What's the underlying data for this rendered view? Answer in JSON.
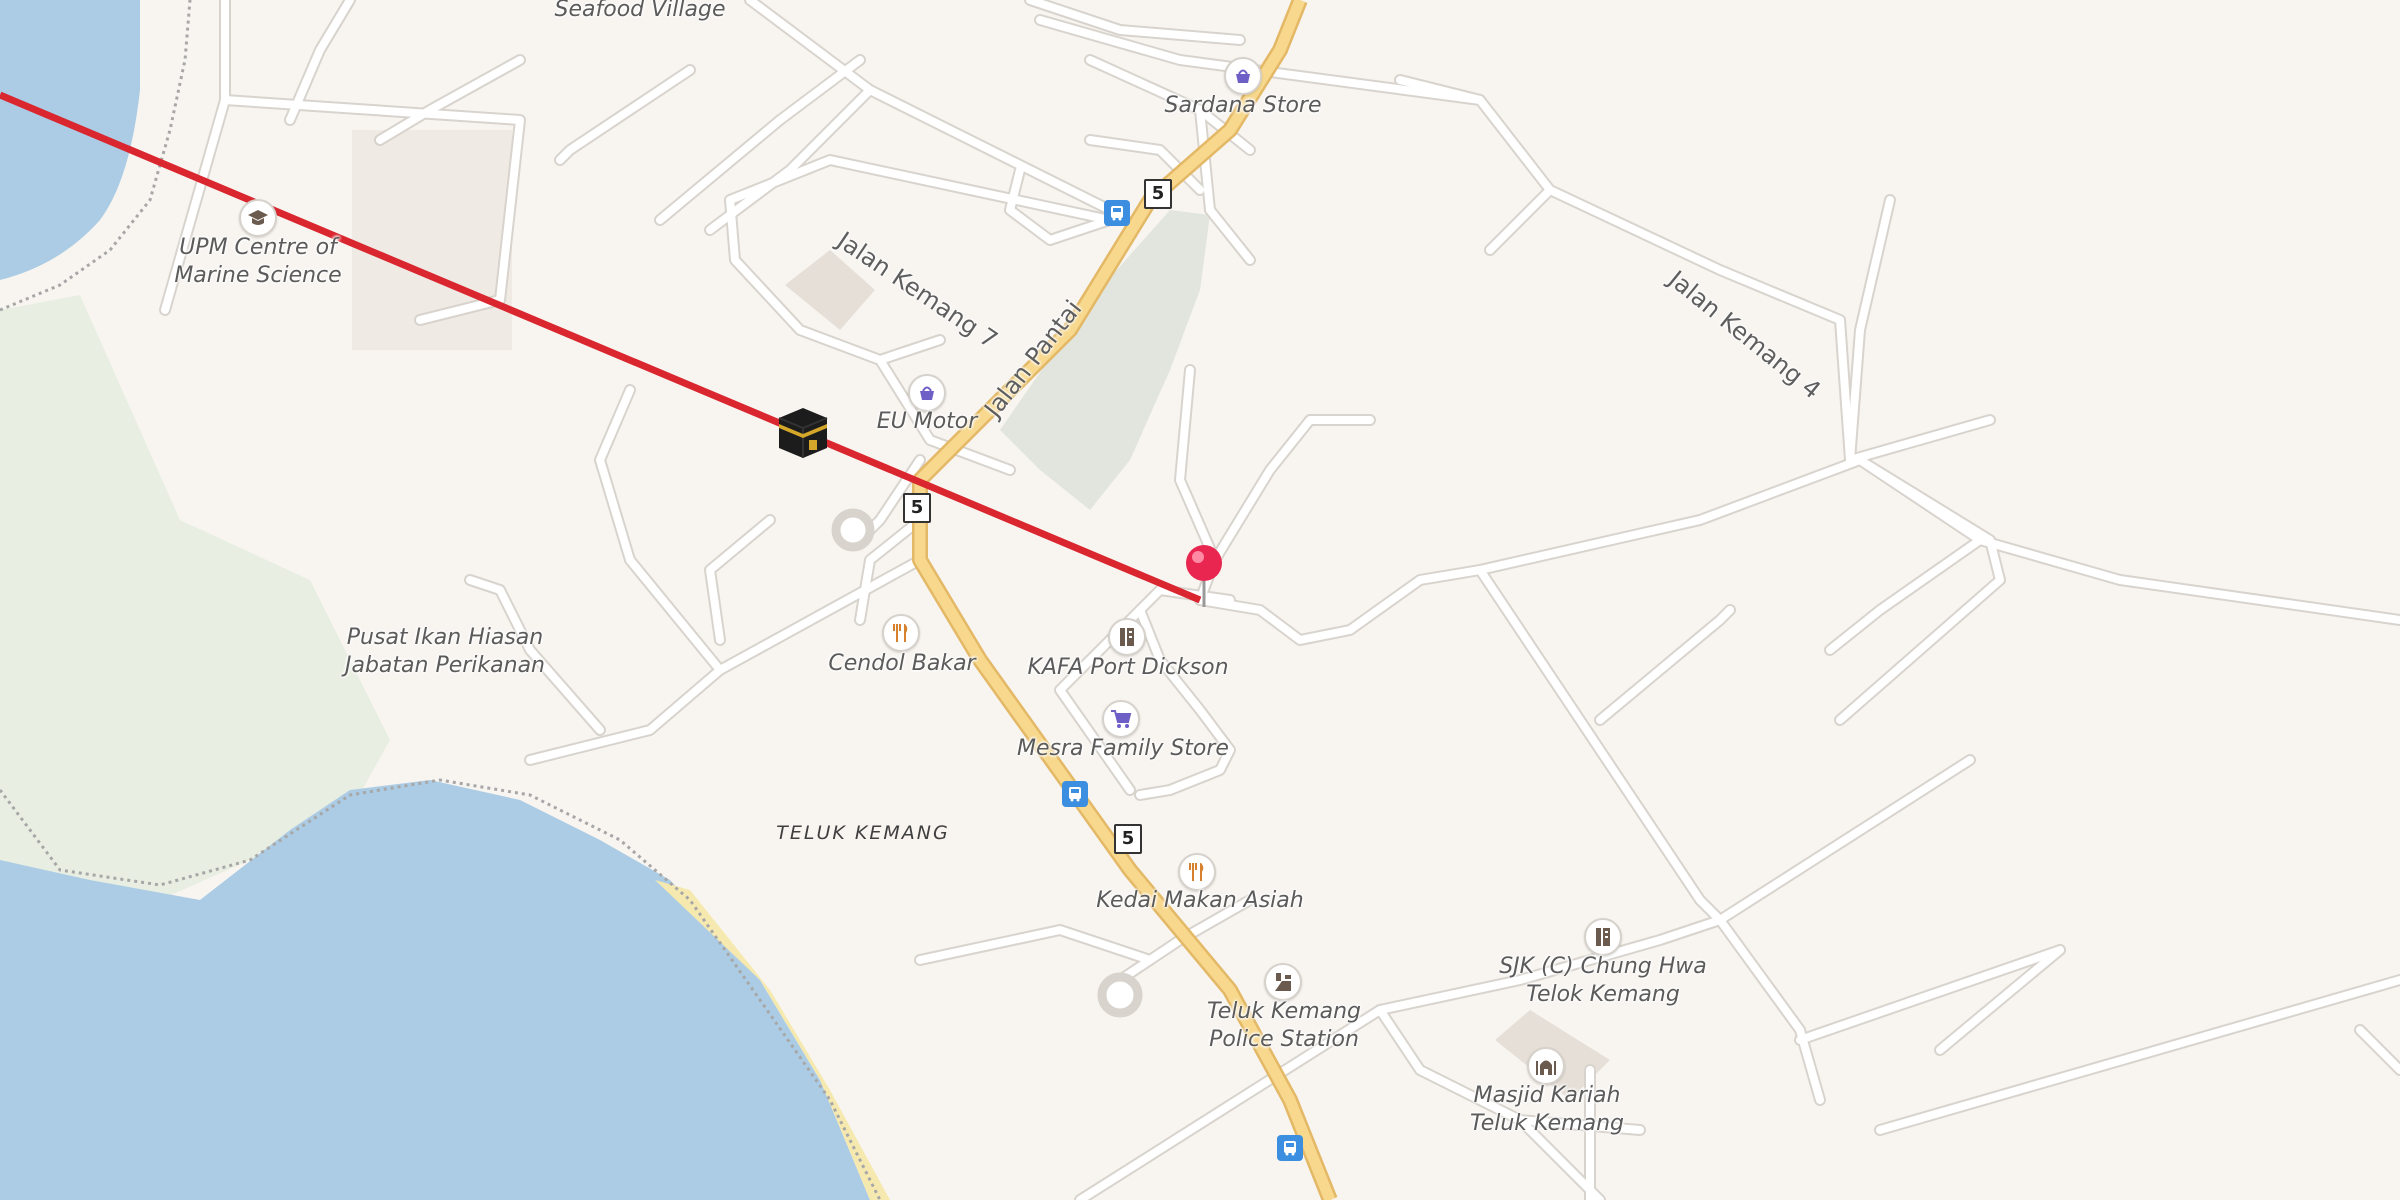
{
  "colors": {
    "water": "#abcce4",
    "land": "#f8f5f1",
    "park": "#e8efe2",
    "road_minor": "#ffffff",
    "road_casing": "#d8d3cd",
    "main_road": "#f7d88d",
    "main_road_casing": "#e3b866",
    "beach": "#f6e9b0",
    "qibla_line": "#d9262f",
    "pin": "#e8264f",
    "poi_purple": "#6e5fc7",
    "poi_orange": "#d7812e",
    "poi_brown": "#6b5a4e",
    "bus_blue": "#3b8ee0"
  },
  "places": {
    "seafood": "Seafood Village",
    "sardana": "Sardana Store",
    "upm": [
      "UPM Centre of",
      "Marine Science"
    ],
    "eu_motor": "EU Motor",
    "pusat": [
      "Pusat Ikan Hiasan",
      "Jabatan Perikanan"
    ],
    "cendol": "Cendol Bakar",
    "kafa": "KAFA Port Dickson",
    "mesra": "Mesra Family Store",
    "kedai": "Kedai Makan Asiah",
    "police": [
      "Teluk Kemang",
      "Police Station"
    ],
    "sjk": [
      "SJK (C) Chung Hwa",
      "Telok Kemang"
    ],
    "masjid": [
      "Masjid Kariah",
      "Teluk Kemang"
    ]
  },
  "area_label": "TELUK KEMANG",
  "streets": {
    "pantai": "Jalan Pantai",
    "kemang7": "Jalan Kemang 7",
    "kemang4": "Jalan Kemang 4"
  },
  "route_number": "5",
  "icons": {
    "kaaba": "kaaba-icon",
    "pin": "location-pin-icon",
    "basket": "shopping-basket-icon",
    "cart": "shopping-cart-icon",
    "food": "fork-knife-icon",
    "school": "school-icon",
    "graduation": "graduation-cap-icon",
    "police": "police-icon",
    "mosque": "mosque-icon",
    "bus": "bus-stop-icon"
  }
}
